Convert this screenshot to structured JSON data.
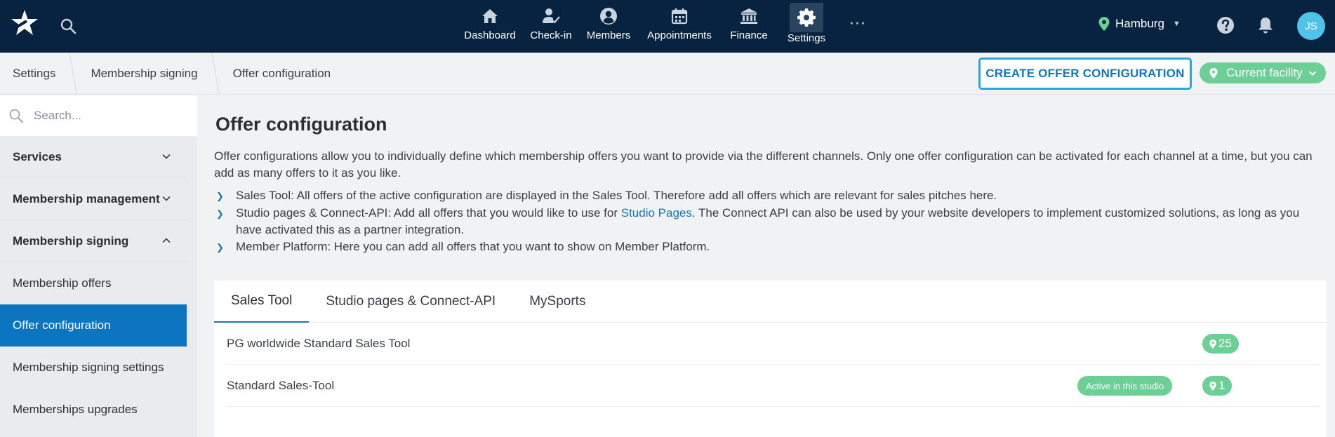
{
  "topbar": {
    "nav": [
      {
        "label": "Dashboard",
        "icon": "home-icon"
      },
      {
        "label": "Check-in",
        "icon": "checkin-icon"
      },
      {
        "label": "Members",
        "icon": "members-icon"
      },
      {
        "label": "Appointments",
        "icon": "calendar-icon"
      },
      {
        "label": "Finance",
        "icon": "bank-icon"
      },
      {
        "label": "Settings",
        "icon": "gear-icon"
      }
    ],
    "more_label": "···",
    "location": "Hamburg",
    "avatar_initials": "JS"
  },
  "breadcrumb": {
    "items": [
      "Settings",
      "Membership signing",
      "Offer configuration"
    ]
  },
  "actions": {
    "create_label": "CREATE OFFER CONFIGURATION",
    "facility_label": "Current facility"
  },
  "sidebar": {
    "search_placeholder": "Search...",
    "groups": [
      {
        "label": "Services",
        "expanded": false
      },
      {
        "label": "Membership management",
        "expanded": false
      },
      {
        "label": "Membership signing",
        "expanded": true
      }
    ],
    "subitems": [
      {
        "label": "Membership offers",
        "active": false
      },
      {
        "label": "Offer configuration",
        "active": true
      },
      {
        "label": "Membership signing settings",
        "active": false
      },
      {
        "label": "Memberships upgrades",
        "active": false
      }
    ]
  },
  "main": {
    "title": "Offer configuration",
    "description": "Offer configurations allow you to individually define which membership offers you want to provide via the different channels. Only one offer configuration can be activated for each channel at a time, but you can add as many offers to it as you like.",
    "bullets": {
      "sales_tool": "Sales Tool: All offers of the active configuration are displayed in the Sales Tool. Therefore add all offers which are relevant for sales pitches here.",
      "studio_prefix": "Studio pages & Connect-API: Add all offers that you would like to use for ",
      "studio_link": "Studio Pages",
      "studio_suffix": ". The Connect API can also be used by your website developers to implement customized solutions, as long as you have activated this as a partner integration.",
      "member_platform": "Member Platform: Here you can add all offers that you want to show on Member Platform."
    },
    "tabs": [
      "Sales Tool",
      "Studio pages & Connect-API",
      "MySports"
    ],
    "active_tab": "Sales Tool",
    "rows": [
      {
        "name": "PG worldwide Standard Sales Tool",
        "status": "",
        "count": "25"
      },
      {
        "name": "Standard Sales-Tool",
        "status": "Active in this studio",
        "count": "1"
      }
    ]
  },
  "colors": {
    "topbar": "#07233f",
    "accent_blue": "#1576b8",
    "highlight_border": "#2aa7df",
    "green": "#6ccf95",
    "avatar": "#4fc3e8",
    "sidebar_active": "#0d74bf"
  }
}
